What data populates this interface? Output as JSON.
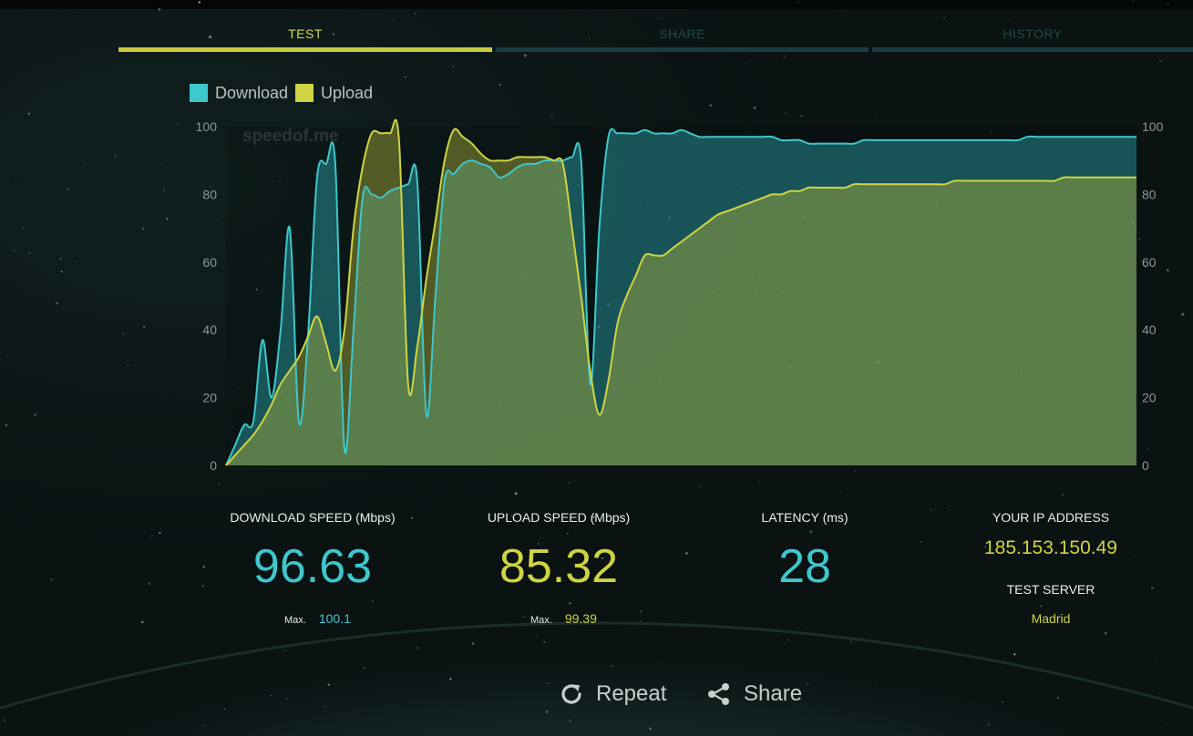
{
  "tabs": [
    {
      "label": "TEST",
      "active": true
    },
    {
      "label": "SHARE",
      "active": false
    },
    {
      "label": "HISTORY",
      "active": false
    }
  ],
  "legend": {
    "download": "Download",
    "upload": "Upload"
  },
  "watermark": "speedof.me",
  "colors": {
    "download": "#3ec7cc",
    "upload": "#cfd443",
    "accent": "#c9ca40"
  },
  "chart_data": {
    "type": "area",
    "title": "",
    "xlabel": "",
    "ylabel": "",
    "ylim": [
      0,
      100
    ],
    "yticks": [
      0,
      20,
      40,
      60,
      80,
      100
    ],
    "grid": false,
    "legend_position": "top-left",
    "x": [
      0,
      1,
      2,
      3,
      4,
      5,
      6,
      7,
      8,
      9,
      10,
      11,
      12,
      13,
      14,
      15,
      16,
      17,
      18,
      19,
      20,
      21,
      22,
      23,
      24,
      25,
      26,
      27,
      28,
      29,
      30,
      31,
      32,
      33,
      34,
      35,
      36,
      37,
      38,
      39,
      40,
      41,
      42,
      43,
      44,
      45,
      46,
      47,
      48,
      49,
      50,
      51,
      52,
      53,
      54,
      55,
      56,
      57,
      58,
      59,
      60,
      61,
      62,
      63,
      64,
      65,
      66,
      67,
      68,
      69,
      70,
      71,
      72,
      73,
      74,
      75,
      76,
      77,
      78,
      79,
      80,
      81,
      82,
      83,
      84,
      85,
      86,
      87,
      88,
      89,
      90,
      91,
      92,
      93,
      94,
      95,
      96,
      97,
      98,
      99,
      100
    ],
    "series": [
      {
        "name": "Download",
        "values": [
          0,
          6,
          12,
          13,
          37,
          20,
          40,
          70,
          13,
          38,
          85,
          89,
          89,
          5,
          40,
          79,
          80,
          79,
          81,
          82,
          83,
          84,
          15,
          50,
          84,
          86,
          89,
          90,
          89,
          88,
          85,
          86,
          88,
          89,
          89,
          90,
          90,
          90,
          91,
          90,
          24,
          70,
          97,
          98,
          98,
          98,
          99,
          98,
          98,
          98,
          99,
          98,
          97,
          97,
          97,
          97,
          97,
          97,
          97,
          97,
          97,
          96,
          96,
          96,
          95,
          95,
          95,
          95,
          95,
          95,
          96,
          96,
          96,
          96,
          96,
          96,
          96,
          96,
          96,
          96,
          96,
          96,
          96,
          96,
          96,
          96,
          96,
          96,
          97,
          97,
          97,
          97,
          97,
          97,
          97,
          97,
          97,
          97,
          97,
          97,
          97
        ]
      },
      {
        "name": "Upload",
        "values": [
          0,
          3,
          6,
          9,
          13,
          18,
          24,
          28,
          32,
          38,
          44,
          36,
          28,
          40,
          70,
          88,
          98,
          98,
          98,
          96,
          24,
          35,
          55,
          72,
          90,
          99,
          97,
          95,
          92,
          90,
          90,
          90,
          91,
          91,
          91,
          91,
          90,
          89,
          70,
          50,
          28,
          15,
          25,
          42,
          50,
          56,
          62,
          62,
          62,
          64,
          66,
          68,
          70,
          72,
          74,
          75,
          76,
          77,
          78,
          79,
          80,
          80,
          81,
          81,
          82,
          82,
          82,
          82,
          82,
          83,
          83,
          83,
          83,
          83,
          83,
          83,
          83,
          83,
          83,
          83,
          84,
          84,
          84,
          84,
          84,
          84,
          84,
          84,
          84,
          84,
          84,
          84,
          85,
          85,
          85,
          85,
          85,
          85,
          85,
          85,
          85
        ]
      }
    ]
  },
  "stats": {
    "download": {
      "label": "DOWNLOAD SPEED (Mbps)",
      "value": "96.63",
      "max_label": "Max.",
      "max_value": "100.1"
    },
    "upload": {
      "label": "UPLOAD SPEED (Mbps)",
      "value": "85.32",
      "max_label": "Max.",
      "max_value": "99.39"
    },
    "latency": {
      "label": "LATENCY (ms)",
      "value": "28"
    },
    "ip": {
      "label": "YOUR IP ADDRESS",
      "value": "185.153.150.49"
    },
    "server": {
      "label": "TEST SERVER",
      "value": "Madrid"
    }
  },
  "actions": {
    "repeat": "Repeat",
    "share": "Share"
  },
  "icons": {
    "repeat": "refresh-icon",
    "share": "share-icon"
  }
}
